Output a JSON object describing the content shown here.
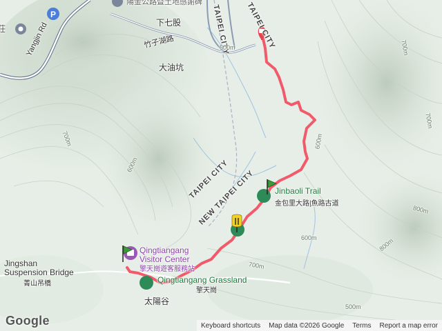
{
  "labels": {
    "xiaqigu": "下七股",
    "zhuzihu_road": "竹子湖路",
    "dayoukeng": "大油坑",
    "yangjin_road": "Yangjin Rd",
    "taipei_city_top": "TAIPEI CITY",
    "taipei_city_top2": "TAIPEI CITY",
    "taipei_city_mid": "TAIPEI CITY",
    "new_taipei_city": "NEW TAIPEI CITY",
    "jinbaoli_trail": "Jinbaoli Trail",
    "jinbaoli_trail_zh": "金包里大路|魚路古道",
    "visitor_center_en_1": "Qingtiangang",
    "visitor_center_en_2": "Visitor Center",
    "visitor_center_zh": "擎天崗遊客服務站",
    "grassland": "Qingtiangang Grassland",
    "qingtiangang_zh": "擎天崗",
    "suspension_bridge_1": "Jingshan",
    "suspension_bridge_2": "Suspension Bridge",
    "suspension_bridge_zh": "菁山吊橋",
    "taiyanggu": "太陽谷",
    "zhuang": "莊",
    "top_cut_text": "陽金公路暨土地感謝碑"
  },
  "elevations": {
    "e1": "700m",
    "e2": "600m",
    "e3": "700m",
    "e4": "800m",
    "e5": "600m",
    "e6": "800m",
    "e7": "600m",
    "e8": "700m",
    "e9": "500m",
    "e10": "700m",
    "e11": "500m"
  },
  "parking": "P",
  "attribution": {
    "logo": "Google",
    "shortcuts": "Keyboard shortcuts",
    "map_data": "Map data ©2026 Google",
    "terms": "Terms",
    "report": "Report a map error"
  },
  "colors": {
    "route": "#f05a6a",
    "start_marker": "#e8424e",
    "flag_green": "#3c9a3c",
    "flag_yellow": "#f2d024",
    "poi_purple": "#9b59b6",
    "poi_green": "#2e8b57"
  }
}
